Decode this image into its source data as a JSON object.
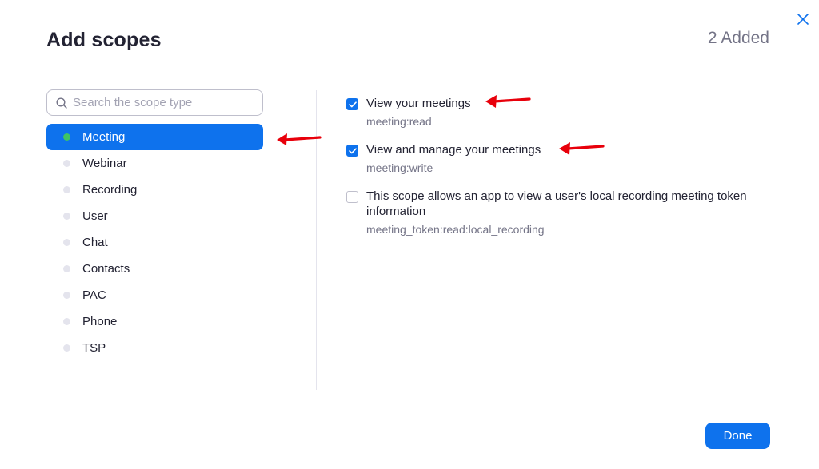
{
  "dialog": {
    "title": "Add scopes",
    "added_count": "2 Added",
    "done_label": "Done"
  },
  "search": {
    "placeholder": "Search the scope type",
    "value": ""
  },
  "categories": [
    {
      "label": "Meeting",
      "active": true
    },
    {
      "label": "Webinar",
      "active": false
    },
    {
      "label": "Recording",
      "active": false
    },
    {
      "label": "User",
      "active": false
    },
    {
      "label": "Chat",
      "active": false
    },
    {
      "label": "Contacts",
      "active": false
    },
    {
      "label": "PAC",
      "active": false
    },
    {
      "label": "Phone",
      "active": false
    },
    {
      "label": "TSP",
      "active": false
    }
  ],
  "scopes": [
    {
      "title": "View your meetings",
      "code": "meeting:read",
      "checked": true
    },
    {
      "title": "View and manage your meetings",
      "code": "meeting:write",
      "checked": true
    },
    {
      "title": "This scope allows an app to view a user's local recording meeting token information",
      "code": "meeting_token:read:local_recording",
      "checked": false
    }
  ],
  "colors": {
    "accent": "#0e72ed",
    "active_dot": "#3fc364",
    "inactive_dot": "#e4e4ed",
    "annotation_arrow": "#e8000b"
  },
  "icons": {
    "close": "close-icon",
    "search": "search-icon",
    "check": "checkmark-icon",
    "annotation": "red-arrow-icon"
  }
}
